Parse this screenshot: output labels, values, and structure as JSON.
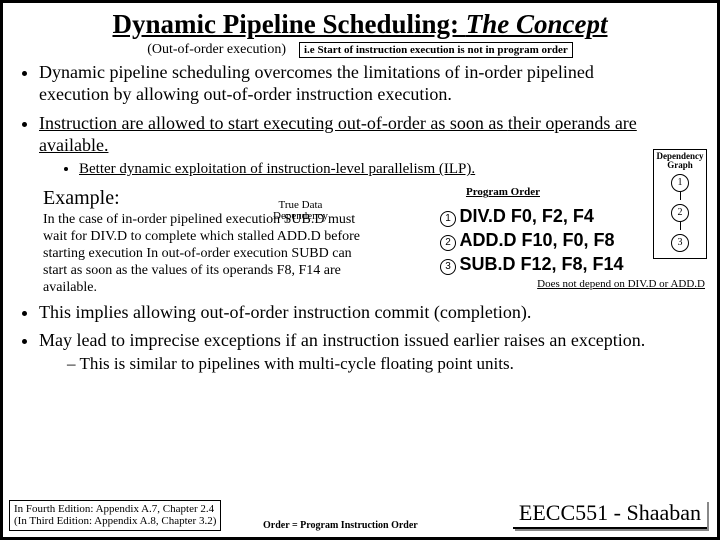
{
  "title_a": "Dynamic Pipeline Scheduling: ",
  "title_b": "The Concept",
  "subtitle_ooo": "(Out-of-order execution)",
  "subtitle_note": "i.e Start of instruction execution is not in program order",
  "bullets": {
    "b1": "Dynamic pipeline scheduling overcomes the limitations of in-order pipelined execution by allowing out-of-order instruction execution.",
    "b2a": "Instruction are allowed to start executing out-of-order as soon as ",
    "b2b": "their operands are available.",
    "b2sub": "Better dynamic exploitation of instruction-level parallelism (ILP).",
    "b3": "This implies allowing out-of-order instruction commit (completion).",
    "b4": "May lead to imprecise exceptions if an instruction issued earlier raises an exception.",
    "b4sub": "This is similar to pipelines with multi-cycle floating point units."
  },
  "dep": {
    "label": "Dependency Graph",
    "n1": "1",
    "n2": "2",
    "n3": "3"
  },
  "example": {
    "label": "Example:",
    "program_order": "Program Order",
    "true_data_a": "True Data",
    "true_data_b": "Dependency",
    "para": "In the case of in-order pipelined execution SUB.D must wait for DIV.D to complete which stalled ADD.D before starting execution In out-of-order execution SUBD can start as soon as the values of its operands F8, F14 are available.",
    "instr": [
      {
        "n": "1",
        "m": "DIV.D   F0, F2, F4"
      },
      {
        "n": "2",
        "m": "ADD.D  F10, F0, F8"
      },
      {
        "n": "3",
        "m": "SUB.D  F12, F8, F14"
      }
    ],
    "note2": "Does not depend on DIV.D or ADD.D"
  },
  "foot": {
    "left_a": "In Fourth Edition: Appendix A.7, Chapter 2.4",
    "left_b": "(In Third Edition: Appendix A.8, Chapter 3.2)",
    "mid": "Order = Program Instruction Order",
    "right": "EECC551 - Shaaban"
  }
}
